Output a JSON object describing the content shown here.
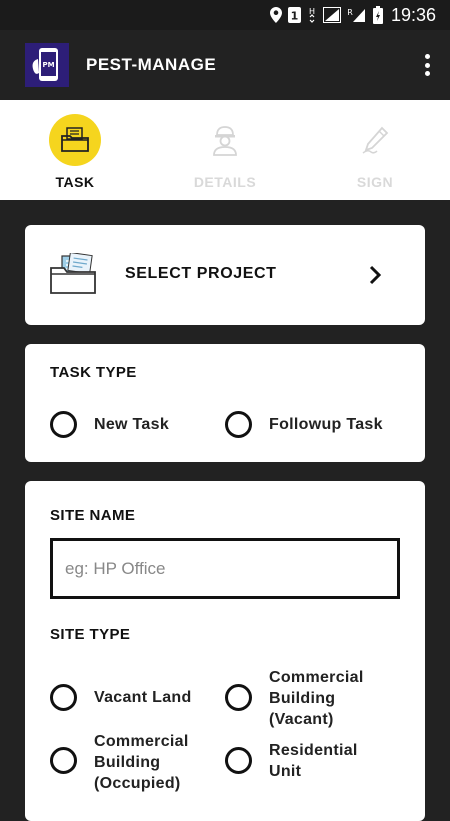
{
  "status_bar": {
    "time": "19:36",
    "icons": [
      "location-icon",
      "sim-1-icon",
      "hd-icon",
      "signal-icon",
      "signal-2-icon",
      "battery-icon"
    ]
  },
  "app_bar": {
    "title": "PEST-MANAGE",
    "logo_text": "PM",
    "menu_icon": "more-vert-icon"
  },
  "tabs": [
    {
      "label": "TASK",
      "icon": "folder-documents-icon",
      "active": true
    },
    {
      "label": "DETAILS",
      "icon": "worker-icon",
      "active": false
    },
    {
      "label": "SIGN",
      "icon": "pen-signature-icon",
      "active": false
    }
  ],
  "colors": {
    "accent": "#f5d51e",
    "dark": "#222222",
    "inactive": "#d9d9d9"
  },
  "select_project": {
    "label": "SELECT PROJECT",
    "icon": "folder-documents-icon",
    "arrow_icon": "chevron-right-icon"
  },
  "task_type": {
    "title": "TASK TYPE",
    "options": [
      "New Task",
      "Followup Task"
    ]
  },
  "site": {
    "name_label": "SITE NAME",
    "name_placeholder": "eg: HP Office",
    "name_value": "",
    "type_label": "SITE TYPE",
    "types": [
      "Vacant Land",
      "Commercial\nBuilding\n(Vacant)",
      "Commercial\nBuilding\n(Occupied)",
      "Residential\nUnit"
    ]
  }
}
